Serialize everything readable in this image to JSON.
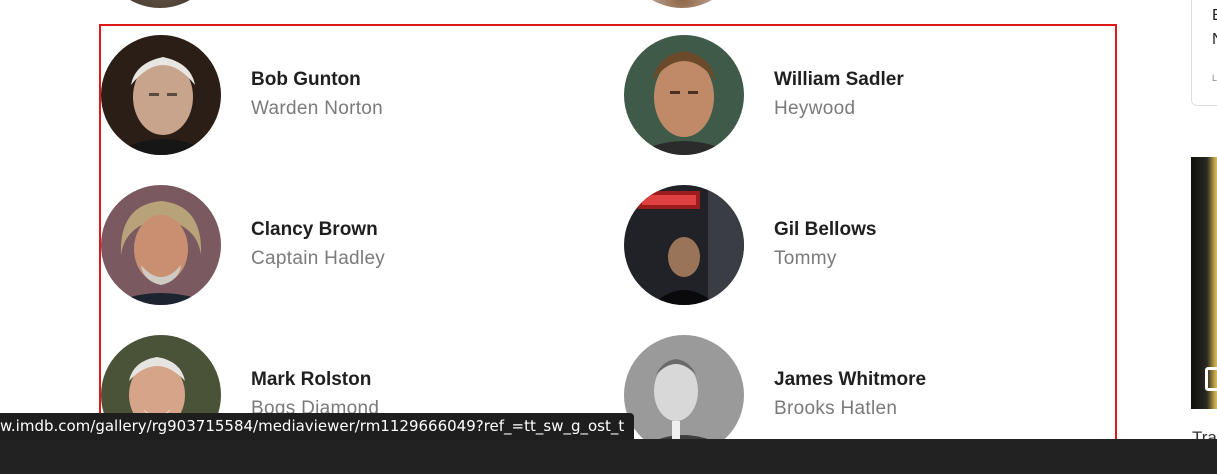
{
  "cast": [
    {
      "name": "Bob Gunton",
      "character": "Warden Norton"
    },
    {
      "name": "William Sadler",
      "character": "Heywood"
    },
    {
      "name": "Clancy Brown",
      "character": "Captain Hadley"
    },
    {
      "name": "Gil Bellows",
      "character": "Tommy"
    },
    {
      "name": "Mark Rolston",
      "character": "Bogs Diamond"
    },
    {
      "name": "James Whitmore",
      "character": "Brooks Hatlen"
    }
  ],
  "status_bar_url": "w.imdb.com/gallery/rg903715584/mediaviewer/rm1129666049?ref_=tt_sw_g_ost_t",
  "sidebar": {
    "card_line1": "E",
    "card_line2": "N",
    "card_tiny": "L",
    "caption": "Tra"
  },
  "colors": {
    "highlight_border": "#e01818",
    "name_text": "#1f1f1f",
    "character_text": "#7a7a7a"
  }
}
